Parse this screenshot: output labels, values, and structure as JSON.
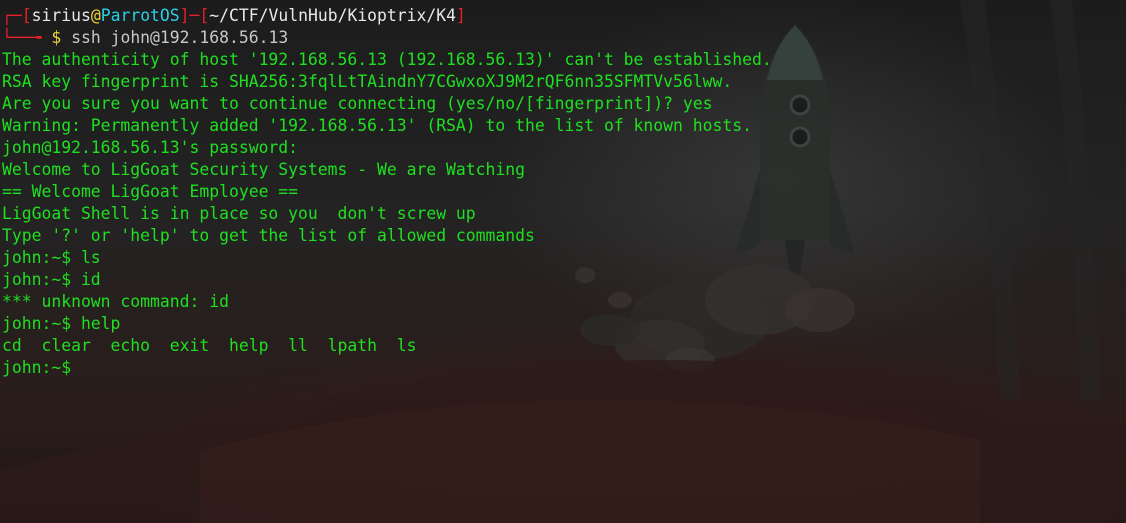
{
  "prompt": {
    "corner_top": "┌─",
    "corner_bottom": "└──╼",
    "bracket_open": "[",
    "user": "sirius",
    "at": "@",
    "host": "ParrotOS",
    "bracket_close": "]",
    "separator": "─",
    "path_bracket_open": "[",
    "path": "~/CTF/VulnHub/Kioptrix/K4",
    "path_bracket_close": "]",
    "dollar": "$",
    "command": "ssh john@192.168.56.13"
  },
  "output_lines": [
    "The authenticity of host '192.168.56.13 (192.168.56.13)' can't be established.",
    "RSA key fingerprint is SHA256:3fqlLtTAindnY7CGwxoXJ9M2rQF6nn35SFMTVv56lww.",
    "Are you sure you want to continue connecting (yes/no/[fingerprint])? yes",
    "Warning: Permanently added '192.168.56.13' (RSA) to the list of known hosts.",
    "john@192.168.56.13's password: ",
    "Welcome to LigGoat Security Systems - We are Watching",
    "== Welcome LigGoat Employee ==",
    "LigGoat Shell is in place so you  don't screw up",
    "Type '?' or 'help' to get the list of allowed commands",
    "john:~$ ls",
    "john:~$ id",
    "*** unknown command: id",
    "john:~$ help",
    "cd  clear  echo  exit  help  ll  lpath  ls",
    "john:~$ "
  ],
  "colors": {
    "output_green": "#1fe020",
    "prompt_red": "#e5202a",
    "host_cyan": "#2ad0e6",
    "at_yellow": "#f2d23c"
  }
}
